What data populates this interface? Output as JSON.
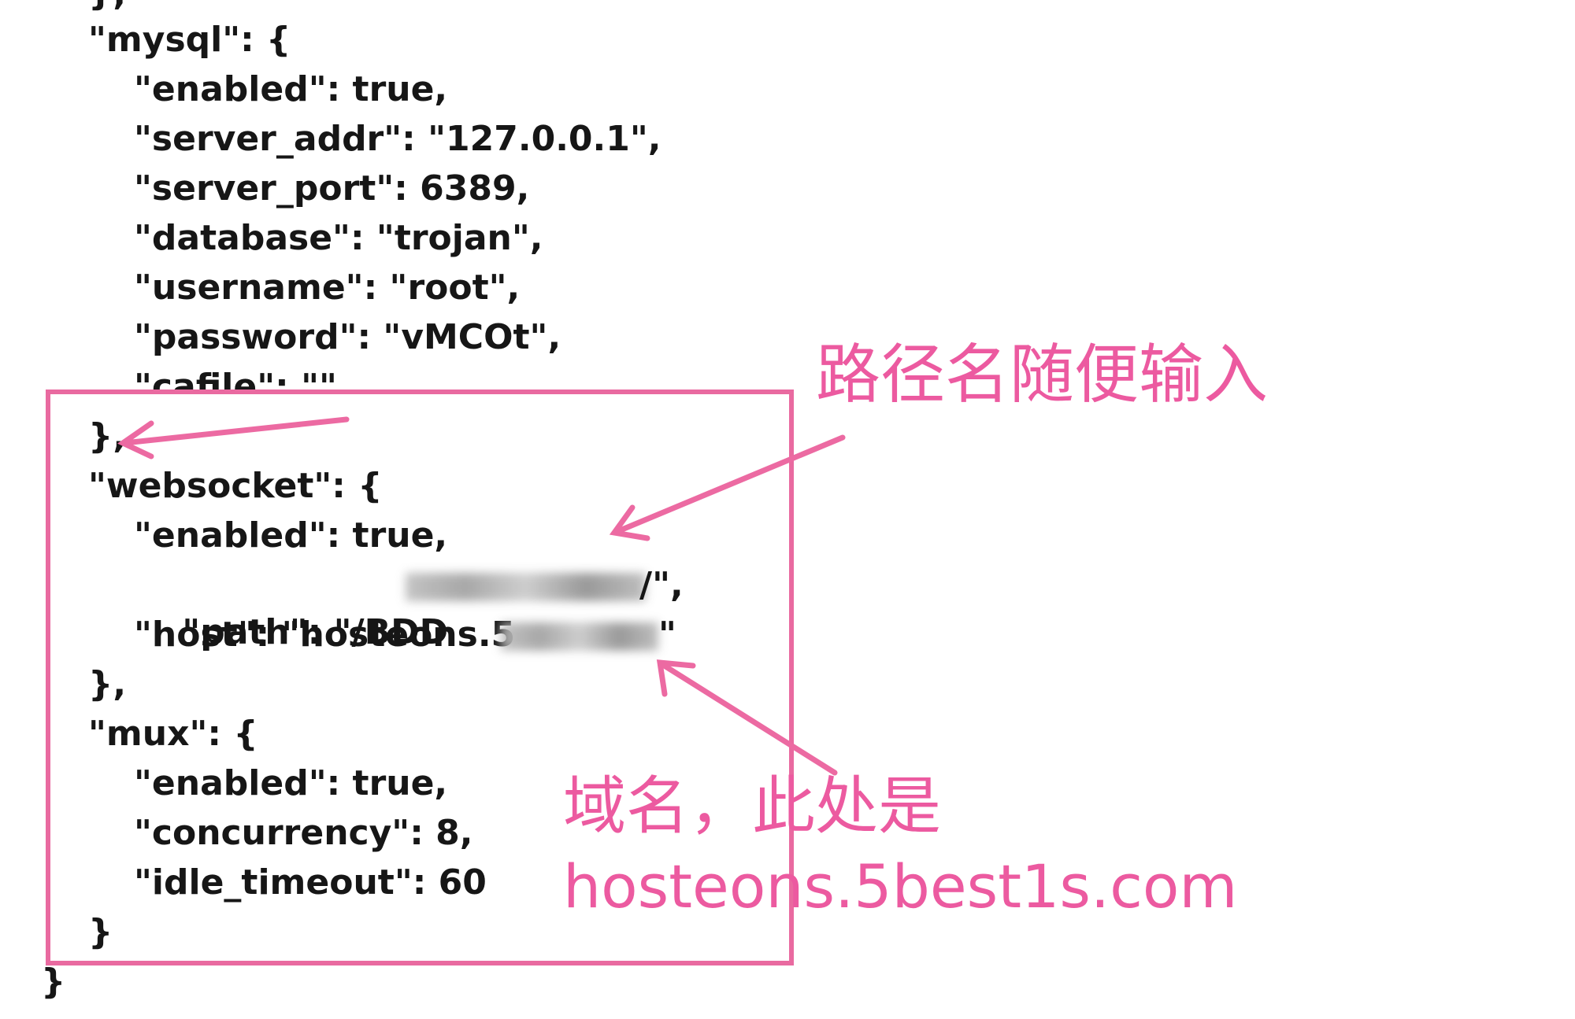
{
  "code": {
    "lines": [
      "},",
      "\"mysql\": {",
      "\"enabled\": true,",
      "\"server_addr\": \"127.0.0.1\",",
      "\"server_port\": 6389,",
      "\"database\": \"trojan\",",
      "\"username\": \"root\",",
      "\"password\": \"vMCOt\",",
      "\"cafile\": \"\"",
      "},",
      "\"websocket\": {",
      "\"enabled\": true,",
      "\"host\": \"hosteons.5",
      "},",
      "\"mux\": {",
      "\"enabled\": true,",
      "\"concurrency\": 8,",
      "\"idle_timeout\": 60",
      "}",
      "}"
    ],
    "path_line": {
      "visible": "\"path\": \"/BDD",
      "tail": "/\","
    },
    "host_tail": "\""
  },
  "annotations": {
    "path_note": "路径名随便输入",
    "domain_note_line1": "域名，此处是",
    "domain_note_line2": "hosteons.5best1s.com",
    "color": "#ec5aa0"
  }
}
